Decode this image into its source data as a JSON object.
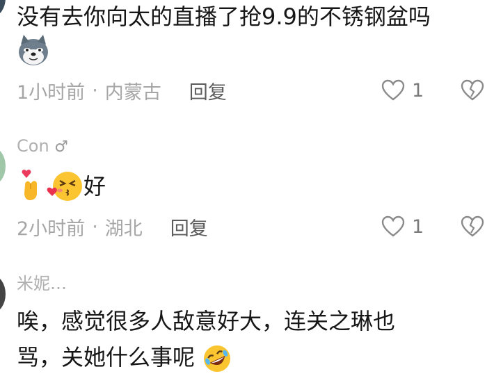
{
  "comments": [
    {
      "text": "没有去你向太的直播了抢9.9的不锈钢盆吗",
      "emoji": "doge-icon",
      "time": "1小时前",
      "location": "内蒙古",
      "reply": "回复",
      "likes": "1"
    },
    {
      "user": "Con",
      "text": "好",
      "emoji": [
        "finger-heart-icon",
        "kissing-face-icon"
      ],
      "time": "2小时前",
      "location": "湖北",
      "reply": "回复",
      "likes": "1"
    },
    {
      "user": "米妮…",
      "line1": "唉，感觉很多人敌意好大，连关之琳也",
      "line2": "骂，关她什么事呢",
      "emoji": "rolling-laughing-icon"
    }
  ],
  "separator": "·"
}
